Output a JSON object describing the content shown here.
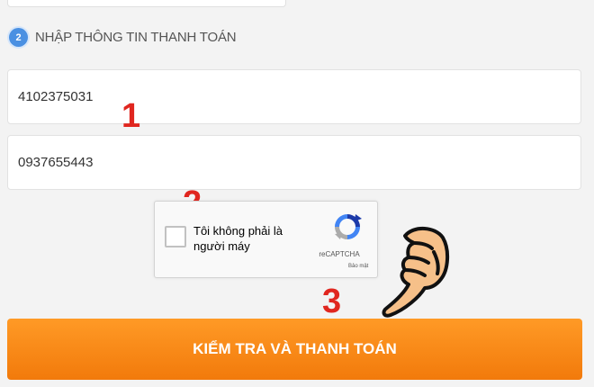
{
  "step": {
    "number": "2",
    "title": "NHẬP THÔNG TIN THANH TOÁN"
  },
  "fields": [
    {
      "value": "4102375031"
    },
    {
      "value": "0937655443"
    }
  ],
  "recaptcha": {
    "label": "Tôi không phải là người máy",
    "brand": "reCAPTCHA",
    "privacy": "Bảo mật",
    "checked": false
  },
  "annotations": {
    "one": "1",
    "two": "2",
    "three": "3"
  },
  "submit": {
    "label": "KIỂM TRA VÀ THANH TOÁN"
  },
  "colors": {
    "accent_orange": "#f7880f",
    "step_blue": "#4a90e2",
    "annotation_red": "#e0261f"
  },
  "icons": {
    "pointer": "pointing-hand-icon",
    "recaptcha": "recaptcha-logo-icon"
  }
}
